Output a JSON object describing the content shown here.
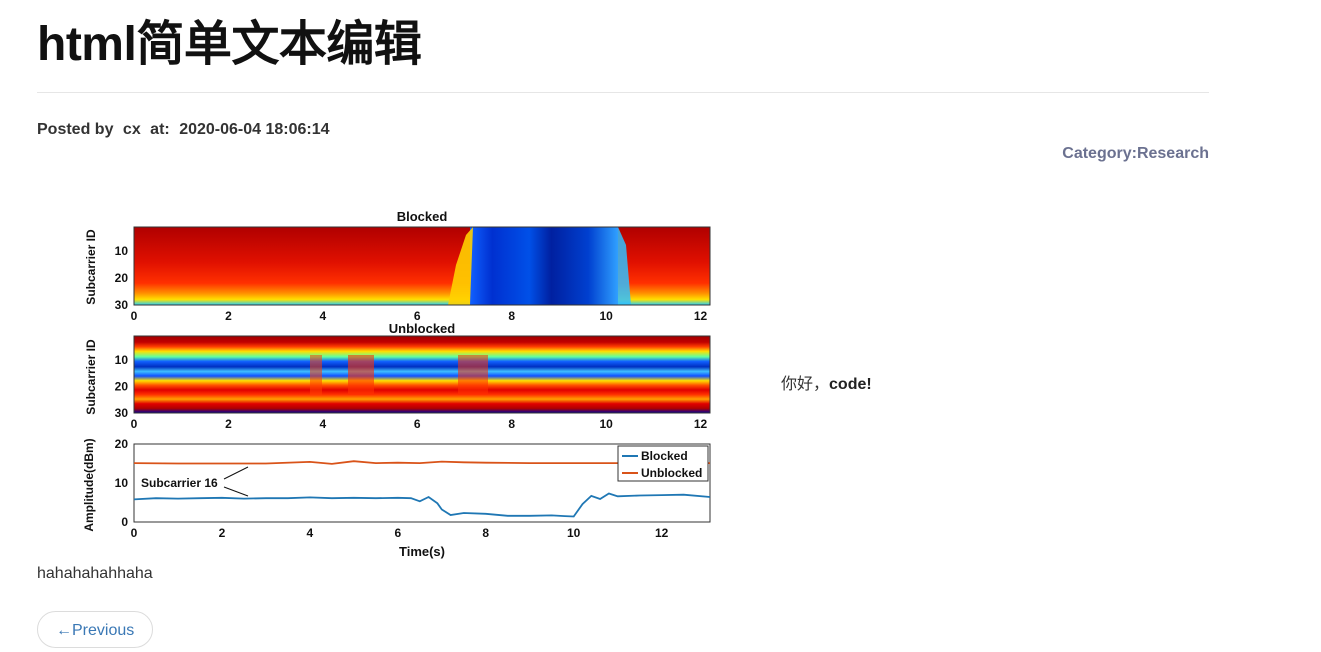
{
  "post": {
    "title": "html简单文本编辑",
    "posted_by_label": "Posted by",
    "author": "cx",
    "at_label": "at:",
    "timestamp": "2020-06-04 18:06:14",
    "category": "Category:Research",
    "inline_text_plain": "你好，",
    "inline_text_bold": "code!",
    "body_text": "hahahahahhaha",
    "prev_label": "←Previous"
  },
  "chart_data": [
    {
      "type": "heatmap",
      "title": "Blocked",
      "xlabel": "",
      "ylabel": "Subcarrier ID",
      "xticks": [
        "0",
        "2",
        "4",
        "6",
        "8",
        "10",
        "12"
      ],
      "yticks": [
        "10",
        "20",
        "30"
      ],
      "xlim": [
        0,
        12.2
      ],
      "ylim": [
        1,
        30
      ],
      "colormap": "jet"
    },
    {
      "type": "heatmap",
      "title": "Unblocked",
      "xlabel": "",
      "ylabel": "Subcarrier ID",
      "xticks": [
        "0",
        "2",
        "4",
        "6",
        "8",
        "10",
        "12"
      ],
      "yticks": [
        "10",
        "20",
        "30"
      ],
      "xlim": [
        0,
        12.2
      ],
      "ylim": [
        1,
        30
      ],
      "colormap": "jet"
    },
    {
      "type": "line",
      "title": "",
      "xlabel": "Time(s)",
      "ylabel": "Amplitude(dBm)",
      "xticks": [
        "0",
        "2",
        "4",
        "6",
        "8",
        "10",
        "12"
      ],
      "yticks": [
        "0",
        "10",
        "20"
      ],
      "xlim": [
        0,
        13.1
      ],
      "ylim": [
        0,
        20
      ],
      "legend_position": "top-right",
      "annotation": "Subcarrier 16",
      "series": [
        {
          "name": "Blocked",
          "color": "#1f77b4",
          "x": [
            0,
            0.5,
            1,
            1.5,
            2,
            2.5,
            3,
            3.5,
            4,
            4.5,
            5,
            5.5,
            6,
            6.3,
            6.5,
            6.7,
            6.9,
            7,
            7.2,
            7.5,
            8,
            8.5,
            9,
            9.5,
            9.8,
            10,
            10.2,
            10.4,
            10.6,
            10.8,
            11,
            11.5,
            12,
            12.5,
            13.1
          ],
          "y": [
            5.8,
            6.1,
            6,
            6.1,
            6.2,
            6,
            6.1,
            6.1,
            6.3,
            6.1,
            6.2,
            6.1,
            6.2,
            6.1,
            5.3,
            6.4,
            4.8,
            3.2,
            1.8,
            2.3,
            2.1,
            1.6,
            1.6,
            1.7,
            1.5,
            1.4,
            4.6,
            6.7,
            5.9,
            7.3,
            6.6,
            6.8,
            6.9,
            7,
            6.4
          ]
        },
        {
          "name": "Unblocked",
          "color": "#d95319",
          "x": [
            0,
            1,
            2,
            3,
            4,
            4.5,
            5,
            5.5,
            6,
            6.5,
            7,
            7.5,
            8,
            9,
            10,
            11,
            11.5,
            12,
            12.5,
            13.1
          ],
          "y": [
            15.1,
            15,
            15,
            15,
            15.4,
            14.9,
            15.6,
            15.1,
            15.2,
            15.1,
            15.5,
            15.3,
            15.2,
            15.1,
            15.1,
            15.1,
            15.2,
            15.1,
            15.2,
            15.1
          ]
        }
      ]
    }
  ]
}
